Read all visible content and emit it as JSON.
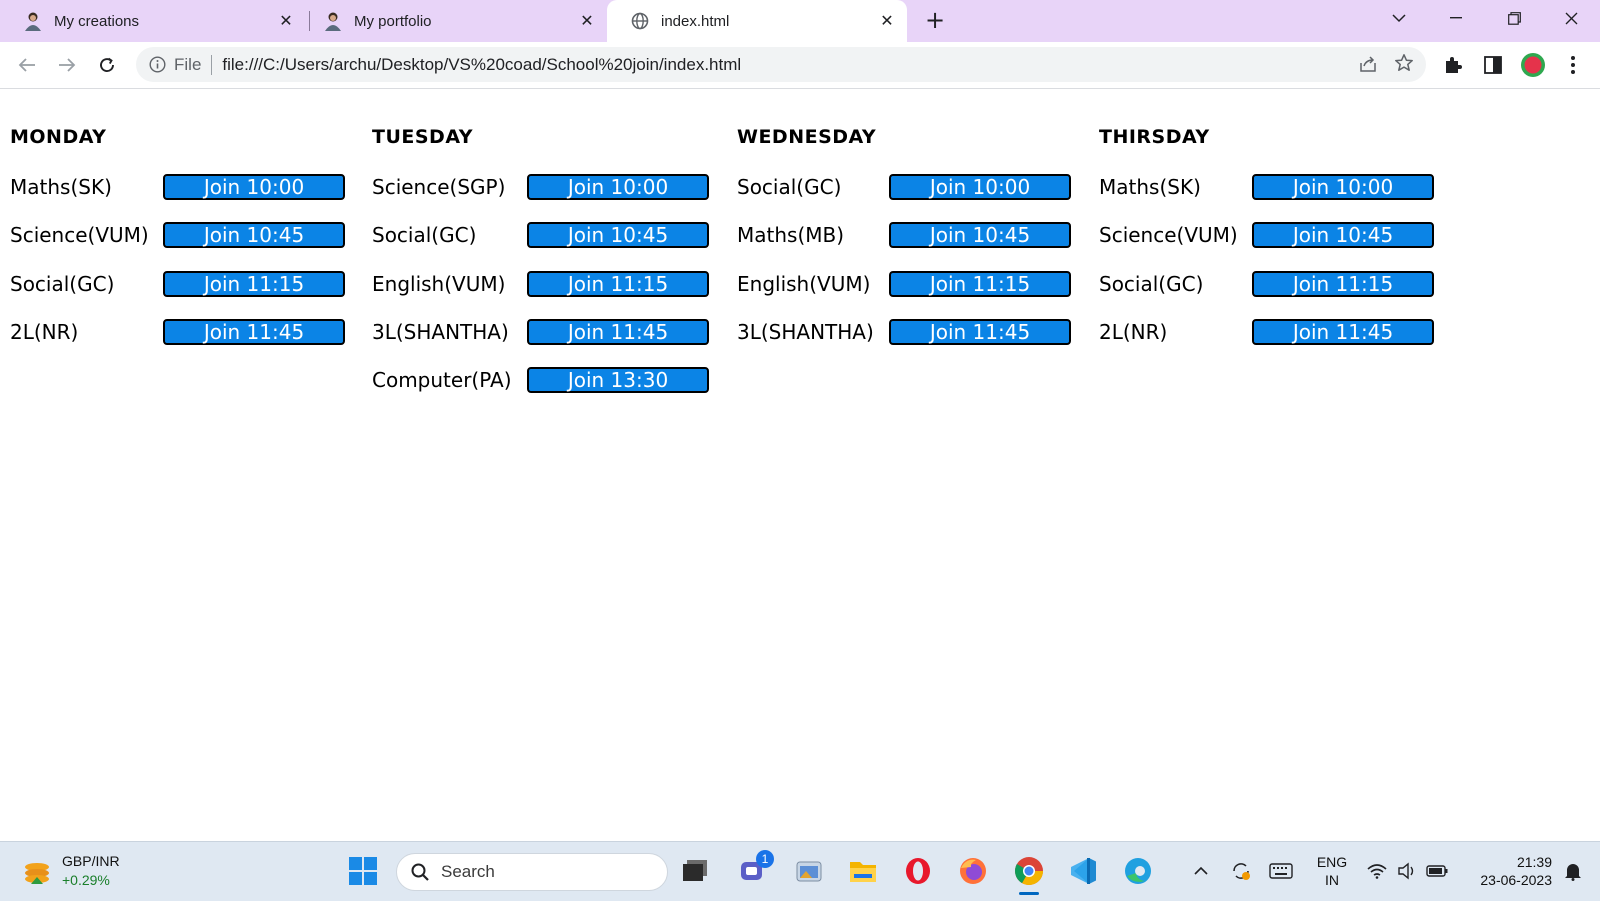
{
  "browser": {
    "tabs": [
      {
        "title": "My creations",
        "active": false
      },
      {
        "title": "My portfolio",
        "active": false
      },
      {
        "title": "index.html",
        "active": true
      }
    ],
    "address": {
      "scheme_label": "File",
      "url": "file:///C:/Users/archu/Desktop/VS%20coad/School%20join/index.html"
    }
  },
  "schedule": [
    {
      "day": "MONDAY",
      "classes": [
        {
          "subject": "Maths(SK)",
          "button": "Join 10:00"
        },
        {
          "subject": "Science(VUM)",
          "button": "Join 10:45"
        },
        {
          "subject": "Social(GC)",
          "button": "Join 11:15"
        },
        {
          "subject": "2L(NR)",
          "button": "Join 11:45"
        }
      ]
    },
    {
      "day": "TUESDAY",
      "classes": [
        {
          "subject": "Science(SGP)",
          "button": "Join 10:00"
        },
        {
          "subject": "Social(GC)",
          "button": "Join 10:45"
        },
        {
          "subject": "English(VUM)",
          "button": "Join 11:15"
        },
        {
          "subject": "3L(SHANTHA)",
          "button": "Join 11:45"
        },
        {
          "subject": "Computer(PA)",
          "button": "Join 13:30"
        }
      ]
    },
    {
      "day": "WEDNESDAY",
      "classes": [
        {
          "subject": "Social(GC)",
          "button": "Join 10:00"
        },
        {
          "subject": "Maths(MB)",
          "button": "Join 10:45"
        },
        {
          "subject": "English(VUM)",
          "button": "Join 11:15"
        },
        {
          "subject": "3L(SHANTHA)",
          "button": "Join 11:45"
        }
      ]
    },
    {
      "day": "THIRSDAY",
      "classes": [
        {
          "subject": "Maths(SK)",
          "button": "Join 10:00"
        },
        {
          "subject": "Science(VUM)",
          "button": "Join 10:45"
        },
        {
          "subject": "Social(GC)",
          "button": "Join 11:15"
        },
        {
          "subject": "2L(NR)",
          "button": "Join 11:45"
        }
      ]
    }
  ],
  "taskbar": {
    "widget_title": "GBP/INR",
    "widget_change": "+0.29%",
    "search_placeholder": "Search",
    "teams_badge": "1",
    "lang_line1": "ENG",
    "lang_line2": "IN",
    "time": "21:39",
    "date": "23-06-2023"
  },
  "colors": {
    "tab_strip": "#e8d4f8",
    "join_button": "#0b84e6",
    "widget_change": "#1a7f2b"
  }
}
